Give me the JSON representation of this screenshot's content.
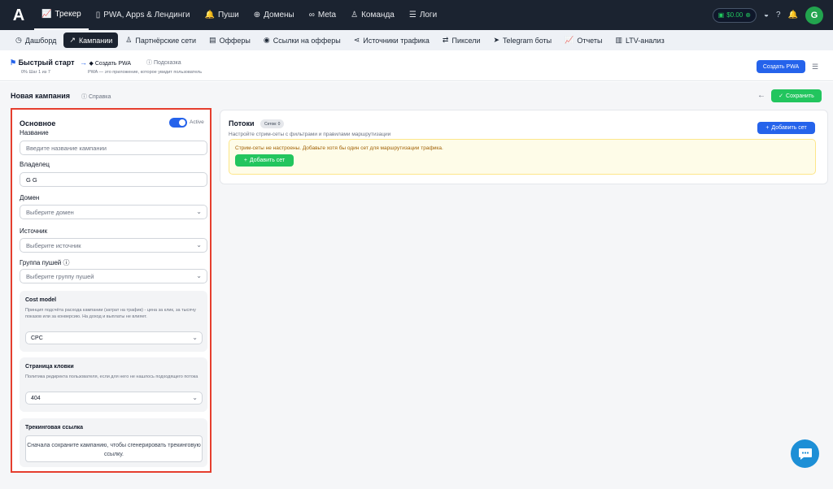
{
  "topnav": {
    "logo": "A",
    "items": [
      {
        "icon": "📈",
        "label": "Трекер"
      },
      {
        "icon": "▯",
        "label": "PWA, Apps & Лендинги"
      },
      {
        "icon": "🔔",
        "label": "Пуши"
      },
      {
        "icon": "⊕",
        "label": "Домены"
      },
      {
        "icon": "∞",
        "label": "Meta"
      },
      {
        "icon": "♙",
        "label": "Команда"
      },
      {
        "icon": "☰",
        "label": "Логи"
      }
    ],
    "balance": "$0.00",
    "avatar_letter": "G"
  },
  "subnav": {
    "items": [
      {
        "icon": "◷",
        "label": "Дашборд"
      },
      {
        "icon": "↗",
        "label": "Кампании"
      },
      {
        "icon": "♙",
        "label": "Партнёрские сети"
      },
      {
        "icon": "▤",
        "label": "Офферы"
      },
      {
        "icon": "◉",
        "label": "Ссылки на офферы"
      },
      {
        "icon": "⋖",
        "label": "Источники трафика"
      },
      {
        "icon": "⇄",
        "label": "Пиксели"
      },
      {
        "icon": "➤",
        "label": "Telegram боты"
      },
      {
        "icon": "📈",
        "label": "Отчеты"
      },
      {
        "icon": "▥",
        "label": "LTV-анализ"
      }
    ]
  },
  "quickstart": {
    "title": "Быстрый старт",
    "progress": "0%  Шаг 1 из 7",
    "step_label": "Создать PWA",
    "hint_label": "Подсказка",
    "step_desc": "PWA — это приложение, которое увидит пользователь",
    "create_pwa_button": "Создать PWA"
  },
  "page": {
    "title": "Новая кампания",
    "help_link": "Справка",
    "save_button": "Сохранить"
  },
  "basic": {
    "section_title": "Основное",
    "active_label": "Active",
    "name_label": "Название",
    "name_placeholder": "Введите название кампании",
    "owner_label": "Владелец",
    "owner_value": "G G",
    "domain_label": "Домен",
    "domain_placeholder": "Выберите домен",
    "source_label": "Источник",
    "source_placeholder": "Выберите источник",
    "pushgroup_label": "Группа пушей",
    "pushgroup_placeholder": "Выберите группу пушей",
    "cost_model_title": "Cost model",
    "cost_model_desc": "Принцип подсчёта расхода кампании (затрат на трафик) - цена за клик, за тысячу показов или за конверсию. На доход и выплаты не влияет.",
    "cost_model_value": "CPC",
    "cloak_title": "Страница кловки",
    "cloak_desc": "Политика редиректа пользователя, если для него не нашлось подходящего потока",
    "cloak_value": "404",
    "tracking_title": "Трекинговая ссылка",
    "tracking_note": "Сначала сохраните кампанию, чтобы сгенерировать трекинговую ссылку."
  },
  "streams": {
    "title": "Потоки",
    "badge": "Сетов: 0",
    "desc": "Настройте стрим-сеты с фильтрами и правилами маршрутизации",
    "add_set_button": "Добавить сет",
    "warning_text": "Стрим-сеты не настроены. Добавьте хотя бы один сет для маршрутизации трафика.",
    "warning_add_button": "Добавить сет"
  }
}
